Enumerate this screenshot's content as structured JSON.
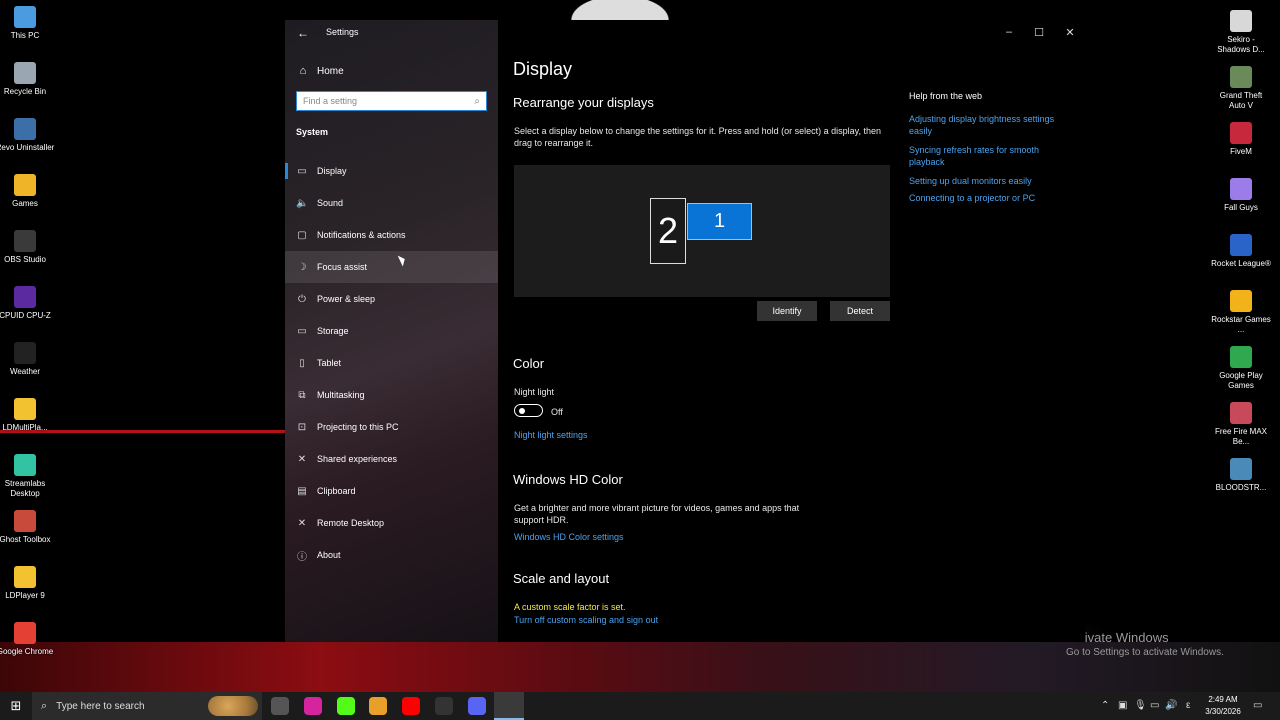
{
  "desktop": {
    "left_icons": [
      {
        "label": "This PC",
        "color": "#4a9be0"
      },
      {
        "label": "Recycle Bin",
        "color": "#9aa6b2"
      },
      {
        "label": "Revo Uninstaller",
        "color": "#3c6ea8"
      },
      {
        "label": "Games",
        "color": "#f0b428"
      },
      {
        "label": "OBS Studio",
        "color": "#3a3a3a"
      },
      {
        "label": "CPUID CPU-Z",
        "color": "#5b2aa0"
      },
      {
        "label": "Weather",
        "color": "#222222"
      },
      {
        "label": "LDMultiPla...",
        "color": "#f2c230"
      },
      {
        "label": "Streamlabs Desktop",
        "color": "#31c3a2"
      },
      {
        "label": "Ghost Toolbox",
        "color": "#c84a3a"
      },
      {
        "label": "LDPlayer 9",
        "color": "#f2c230"
      },
      {
        "label": "Google Chrome",
        "color": "#e44134"
      }
    ],
    "right_icons": [
      {
        "label": "Sekiro - Shadows D...",
        "color": "#d8d8d8"
      },
      {
        "label": "Grand Theft Auto V",
        "color": "#6a8a5a"
      },
      {
        "label": "FiveM",
        "color": "#c8283c"
      },
      {
        "label": "Fall Guys",
        "color": "#9b7ce8"
      },
      {
        "label": "Rocket League®",
        "color": "#2a64c8"
      },
      {
        "label": "Rockstar Games ...",
        "color": "#f2b21a"
      },
      {
        "label": "Google Play Games",
        "color": "#2fa84f"
      },
      {
        "label": "Free Fire MAX Be...",
        "color": "#c84a5a"
      },
      {
        "label": "BLOODSTR...",
        "color": "#4a8ab8"
      }
    ],
    "watermark": {
      "line1": "Activate Windows",
      "line2": "Go to Settings to activate Windows."
    }
  },
  "settings": {
    "title": "Settings",
    "nav": {
      "home": "Home",
      "search_placeholder": "Find a setting",
      "section": "System",
      "items": [
        {
          "label": "Display",
          "icon": "monitor-icon",
          "glyph": "▭"
        },
        {
          "label": "Sound",
          "icon": "speaker-icon",
          "glyph": "🔈"
        },
        {
          "label": "Notifications & actions",
          "icon": "notification-icon",
          "glyph": "▢"
        },
        {
          "label": "Focus assist",
          "icon": "moon-icon",
          "glyph": "☽"
        },
        {
          "label": "Power & sleep",
          "icon": "power-icon",
          "glyph": "⏻"
        },
        {
          "label": "Storage",
          "icon": "storage-icon",
          "glyph": "▭"
        },
        {
          "label": "Tablet",
          "icon": "tablet-icon",
          "glyph": "▯"
        },
        {
          "label": "Multitasking",
          "icon": "multitasking-icon",
          "glyph": "⧉"
        },
        {
          "label": "Projecting to this PC",
          "icon": "projecting-icon",
          "glyph": "⊡"
        },
        {
          "label": "Shared experiences",
          "icon": "shared-icon",
          "glyph": "✕"
        },
        {
          "label": "Clipboard",
          "icon": "clipboard-icon",
          "glyph": "▤"
        },
        {
          "label": "Remote Desktop",
          "icon": "remote-icon",
          "glyph": "✕"
        },
        {
          "label": "About",
          "icon": "info-icon",
          "glyph": "ⓘ"
        }
      ]
    },
    "content": {
      "page_title": "Display",
      "rearrange_heading": "Rearrange your displays",
      "rearrange_desc": "Select a display below to change the settings for it. Press and hold (or select) a display, then drag to rearrange it.",
      "monitor_2": "2",
      "monitor_1": "1",
      "identify_button": "Identify",
      "detect_button": "Detect",
      "color_heading": "Color",
      "night_light_label": "Night light",
      "night_light_state": "Off",
      "night_light_link": "Night light settings",
      "hdr_heading": "Windows HD Color",
      "hdr_desc": "Get a brighter and more vibrant picture for videos, games and apps that support HDR.",
      "hdr_link": "Windows HD Color settings",
      "scale_heading": "Scale and layout",
      "scale_warning": "A custom scale factor is set.",
      "scale_link": "Turn off custom scaling and sign out"
    },
    "help": {
      "title": "Help from the web",
      "links": [
        "Adjusting display brightness settings easily",
        "Syncing refresh rates for smooth playback",
        "Setting up dual monitors easily",
        "Connecting to a projector or PC"
      ]
    }
  },
  "taskbar": {
    "search_placeholder": "Type here to search",
    "apps": [
      {
        "name": "obs-taskbar-icon",
        "color": "#555555"
      },
      {
        "name": "instagram-taskbar-icon",
        "color": "#d6249f"
      },
      {
        "name": "kick-taskbar-icon",
        "color": "#53fc18"
      },
      {
        "name": "chrome-taskbar-icon",
        "color": "#e8a02a"
      },
      {
        "name": "youtube-taskbar-icon",
        "color": "#ff0000"
      },
      {
        "name": "app-taskbar-icon",
        "color": "#333333"
      },
      {
        "name": "discord-taskbar-icon",
        "color": "#5865f2"
      },
      {
        "name": "settings-taskbar-icon",
        "color": "#3a3a3a"
      }
    ],
    "tray_lang": "ε",
    "time": "2:49 AM",
    "date": "3/30/2026"
  }
}
